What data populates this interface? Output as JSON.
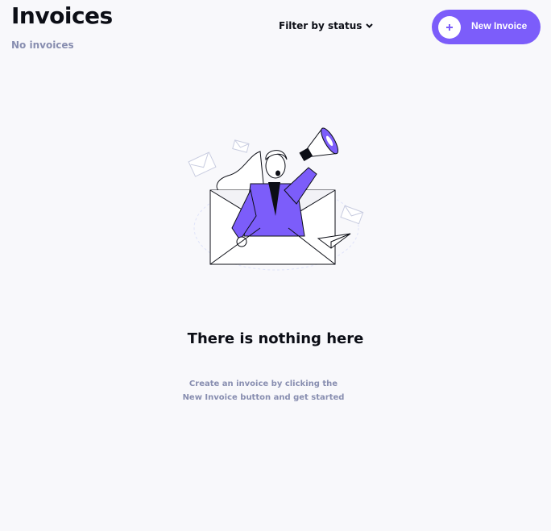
{
  "header": {
    "title": "Invoices",
    "subtitle": "No invoices",
    "filter_label": "Filter by status",
    "new_invoice_label": "New Invoice"
  },
  "empty_state": {
    "title": "There is nothing here",
    "description_line1": "Create an invoice by clicking the",
    "description_line2": "New Invoice button and get started",
    "illustration": "woman-with-megaphone-in-envelope"
  },
  "colors": {
    "accent": "#7C5DFA",
    "background": "#F8F8FB",
    "text_primary": "#0C0E16",
    "text_secondary": "#888EB0"
  },
  "icons": {
    "filter": "chevron-down-icon",
    "new_invoice": "plus-icon"
  }
}
